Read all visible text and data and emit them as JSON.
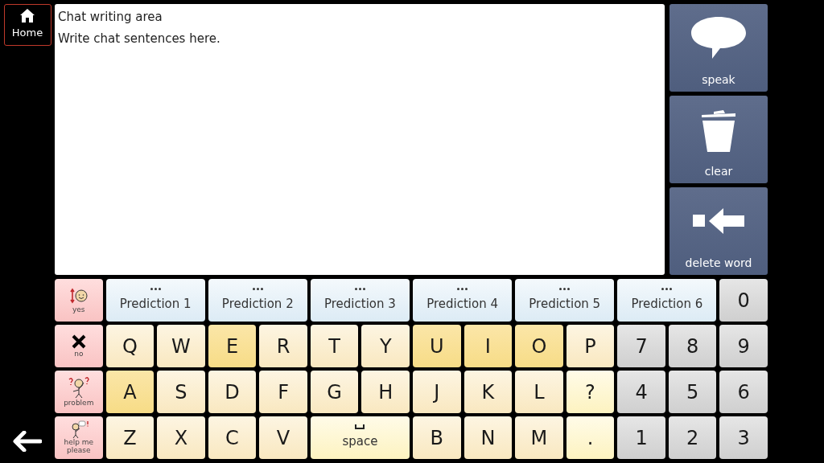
{
  "home_button": {
    "label": "Home"
  },
  "chat_area": {
    "title": "Chat writing area",
    "placeholder": "Write chat sentences here."
  },
  "side_buttons": [
    {
      "kind": "speak",
      "label": "speak"
    },
    {
      "kind": "clear",
      "label": "clear"
    },
    {
      "kind": "delete",
      "label": "delete word"
    }
  ],
  "keyboard_rows": [
    [
      {
        "kind": "quick",
        "label": "yes"
      },
      {
        "kind": "prediction",
        "label": "Prediction 1"
      },
      {
        "kind": "prediction",
        "label": "Prediction 2"
      },
      {
        "kind": "prediction",
        "label": "Prediction 3"
      },
      {
        "kind": "prediction",
        "label": "Prediction 4"
      },
      {
        "kind": "prediction",
        "label": "Prediction 5"
      },
      {
        "kind": "prediction",
        "label": "Prediction 6"
      },
      {
        "kind": "number",
        "label": "0"
      }
    ],
    [
      {
        "kind": "quick",
        "label": "no"
      },
      {
        "kind": "consonant",
        "label": "Q"
      },
      {
        "kind": "consonant",
        "label": "W"
      },
      {
        "kind": "vowel",
        "label": "E"
      },
      {
        "kind": "consonant",
        "label": "R"
      },
      {
        "kind": "consonant",
        "label": "T"
      },
      {
        "kind": "consonant",
        "label": "Y"
      },
      {
        "kind": "vowel",
        "label": "U"
      },
      {
        "kind": "vowel",
        "label": "I"
      },
      {
        "kind": "vowel",
        "label": "O"
      },
      {
        "kind": "consonant",
        "label": "P"
      },
      {
        "kind": "number",
        "label": "7"
      },
      {
        "kind": "number",
        "label": "8"
      },
      {
        "kind": "number",
        "label": "9"
      }
    ],
    [
      {
        "kind": "quick",
        "label": "problem"
      },
      {
        "kind": "vowel",
        "label": "A"
      },
      {
        "kind": "consonant",
        "label": "S"
      },
      {
        "kind": "consonant",
        "label": "D"
      },
      {
        "kind": "consonant",
        "label": "F"
      },
      {
        "kind": "consonant",
        "label": "G"
      },
      {
        "kind": "consonant",
        "label": "H"
      },
      {
        "kind": "consonant",
        "label": "J"
      },
      {
        "kind": "consonant",
        "label": "K"
      },
      {
        "kind": "consonant",
        "label": "L"
      },
      {
        "kind": "punctuation",
        "label": "?"
      },
      {
        "kind": "number",
        "label": "4"
      },
      {
        "kind": "number",
        "label": "5"
      },
      {
        "kind": "number",
        "label": "6"
      }
    ],
    [
      {
        "kind": "quick",
        "label": "help me please"
      },
      {
        "kind": "consonant",
        "label": "Z"
      },
      {
        "kind": "consonant",
        "label": "X"
      },
      {
        "kind": "consonant",
        "label": "C"
      },
      {
        "kind": "consonant",
        "label": "V"
      },
      {
        "kind": "space",
        "label": "space"
      },
      {
        "kind": "consonant",
        "label": "B"
      },
      {
        "kind": "consonant",
        "label": "N"
      },
      {
        "kind": "consonant",
        "label": "M"
      },
      {
        "kind": "punctuation",
        "label": "."
      },
      {
        "kind": "number",
        "label": "1"
      },
      {
        "kind": "number",
        "label": "2"
      },
      {
        "kind": "number",
        "label": "3"
      }
    ]
  ]
}
